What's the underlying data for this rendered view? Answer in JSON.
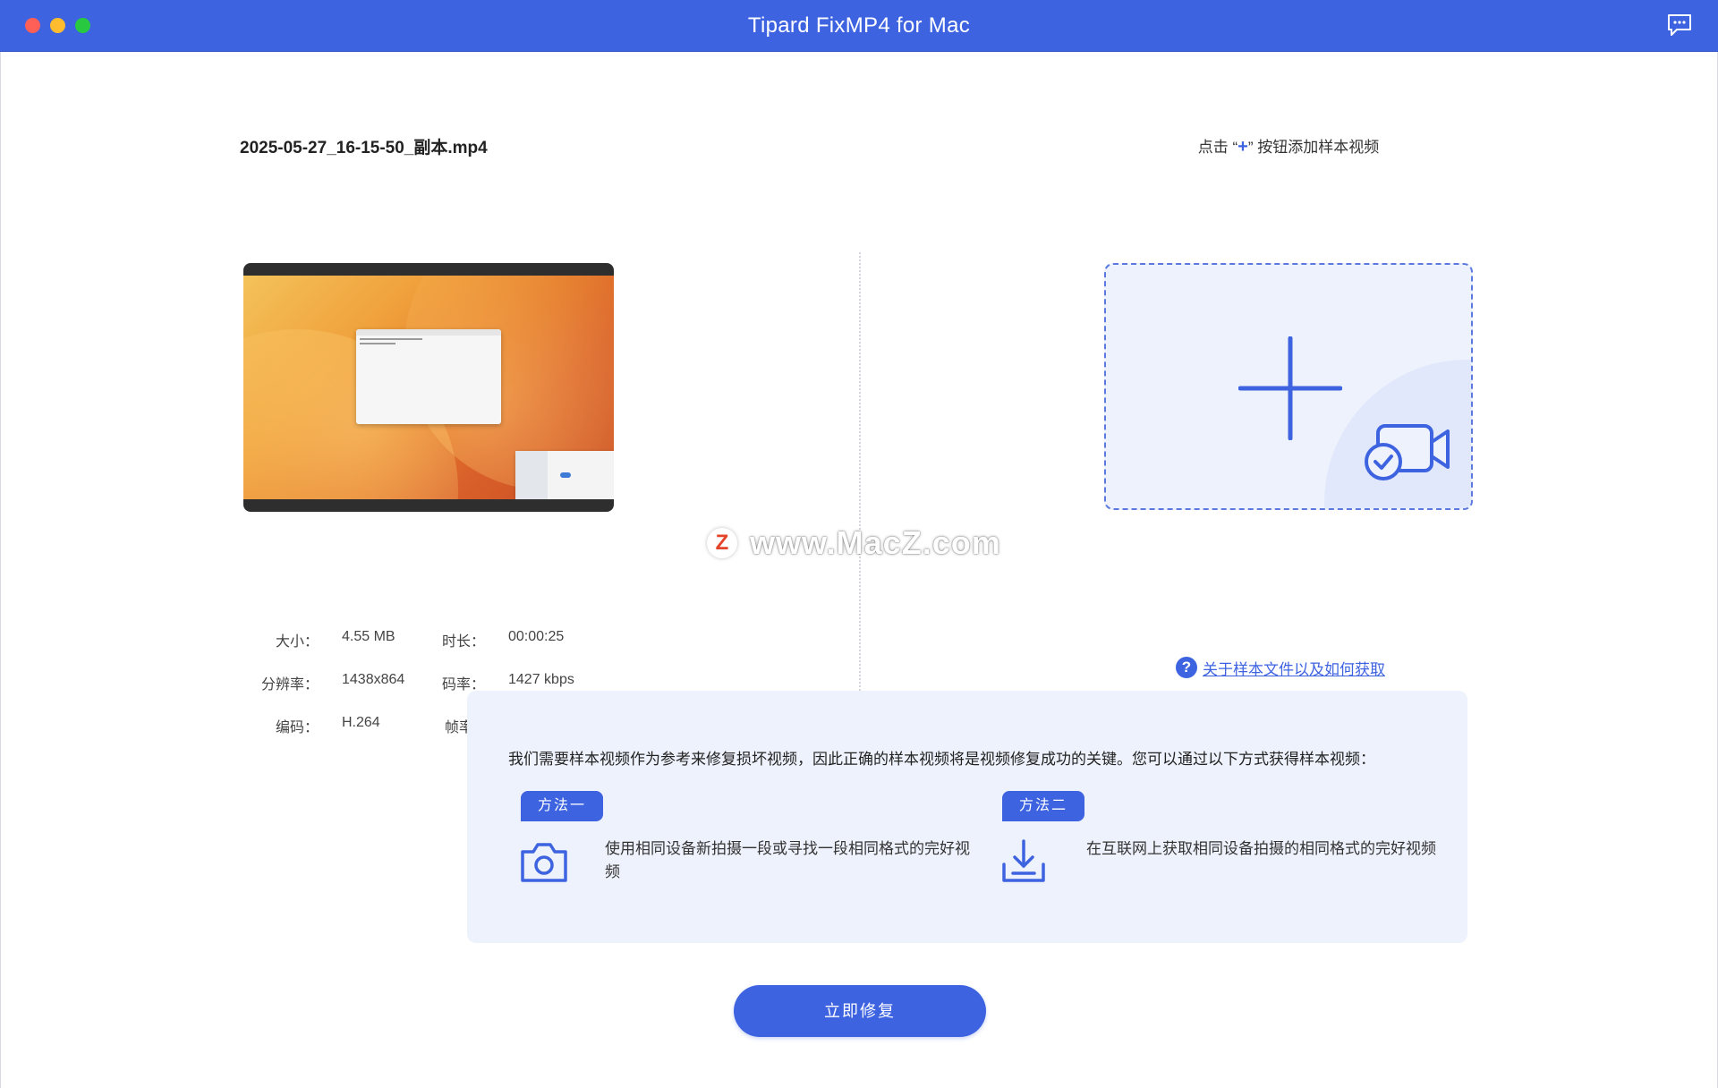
{
  "window": {
    "title": "Tipard FixMP4 for Mac"
  },
  "source": {
    "file_name": "2025-05-27_16-15-50_副本.mp4",
    "info": {
      "size_label": "大小：",
      "size_value": "4.55 MB",
      "duration_label": "时长：",
      "duration_value": "00:00:25",
      "resolution_label": "分辨率：",
      "resolution_value": "1438x864",
      "bitrate_label": "码率：",
      "bitrate_value": "1427 kbps",
      "codec_label": "编码：",
      "codec_value": "H.264",
      "framerate_label": "帧率"
    }
  },
  "sample": {
    "hint_prefix": "点击 “",
    "hint_plus": "+",
    "hint_suffix": "” 按钮添加样本视频",
    "help_icon": "?",
    "help_link": "关于样本文件以及如何获取"
  },
  "popup": {
    "description": "我们需要样本视频作为参考来修复损坏视频，因此正确的样本视频将是视频修复成功的关键。您可以通过以下方式获得样本视频：",
    "method1": {
      "tag": "方法一",
      "icon": "camera-icon",
      "text": "使用相同设备新拍摄一段或寻找一段相同格式的完好视频"
    },
    "method2": {
      "tag": "方法二",
      "icon": "download-icon",
      "text": "在互联网上获取相同设备拍摄的相同格式的完好视频"
    }
  },
  "repair_button": "立即修复",
  "watermark": {
    "logo": "Z",
    "text": "www.MacZ.com"
  },
  "colors": {
    "accent": "#3e63e0",
    "panel_bg": "#eef2fc",
    "close": "#fe5f57",
    "minimize": "#febc2e",
    "maximize": "#28c840"
  }
}
